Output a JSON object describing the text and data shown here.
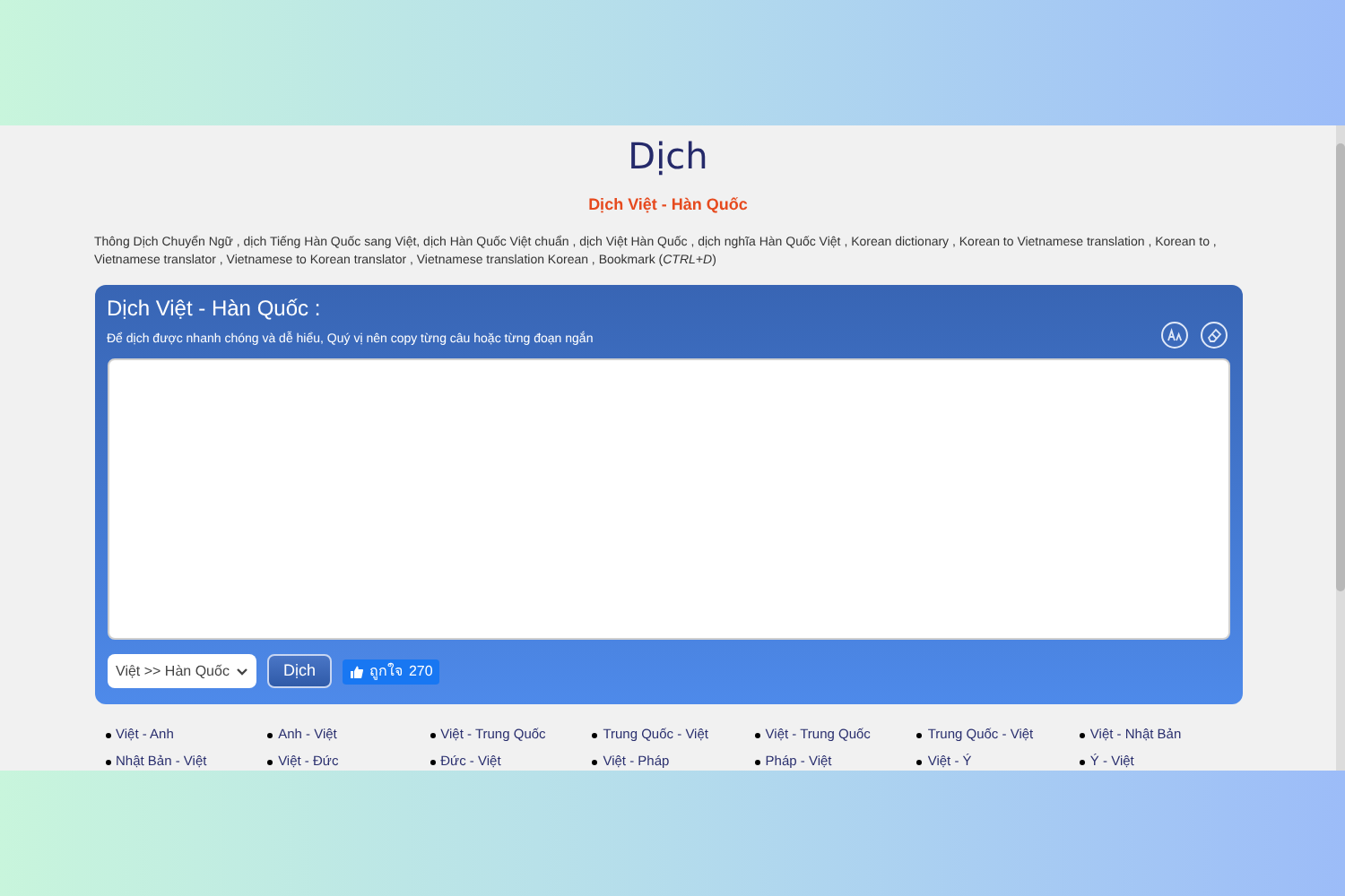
{
  "page": {
    "title": "Dịch",
    "subtitle": "Dịch Việt - Hàn Quốc",
    "description": "Thông Dịch Chuyển Ngữ , dịch Tiếng Hàn Quốc sang Việt, dịch Hàn Quốc Việt chuẩn , dịch Việt Hàn Quốc , dịch nghĩa Hàn Quốc Việt , Korean dictionary , Korean to Vietnamese translation , Korean to , Vietnamese translator , Vietnamese to Korean translator , Vietnamese translation Korean , Bookmark (*CTRL+D*)"
  },
  "translator": {
    "heading": "Dịch Việt - Hàn Quốc :",
    "hint": "Để dịch được nhanh chóng và dễ hiểu, Quý vị nên copy từng câu hoặc từng đoạn ngắn",
    "direction": "Việt >> Hàn Quốc",
    "translate_button": "Dịch",
    "like_label": "ถูกใจ",
    "like_count": "270"
  },
  "links": [
    "Việt - Anh",
    "Anh - Việt",
    "Việt - Trung Quốc",
    "Trung Quốc - Việt",
    "Việt - Trung Quốc",
    "Trung Quốc - Việt",
    "Việt - Nhật Bản",
    "Nhật Bản - Việt",
    "Việt - Đức",
    "Đức - Việt",
    "Việt - Pháp",
    "Pháp - Việt",
    "Việt - Ý",
    "Ý - Việt"
  ]
}
